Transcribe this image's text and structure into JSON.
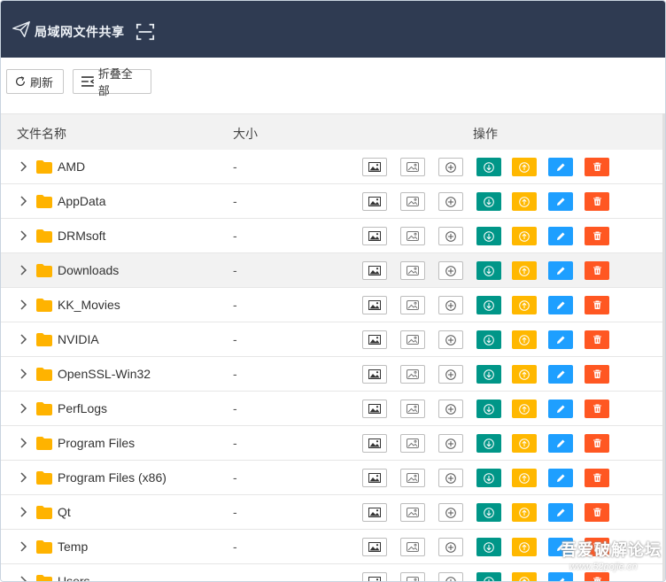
{
  "app": {
    "title": "局域网文件共享"
  },
  "toolbar": {
    "refresh_label": "刷新",
    "collapse_label": "折叠全部"
  },
  "table": {
    "headers": {
      "name": "文件名称",
      "size": "大小",
      "ops": "操作"
    },
    "rows": [
      {
        "name": "AMD",
        "size": "-"
      },
      {
        "name": "AppData",
        "size": "-"
      },
      {
        "name": "DRMsoft",
        "size": "-"
      },
      {
        "name": "Downloads",
        "size": "-"
      },
      {
        "name": "KK_Movies",
        "size": "-"
      },
      {
        "name": "NVIDIA",
        "size": "-"
      },
      {
        "name": "OpenSSL-Win32",
        "size": "-"
      },
      {
        "name": "PerfLogs",
        "size": "-"
      },
      {
        "name": "Program Files",
        "size": "-"
      },
      {
        "name": "Program Files (x86)",
        "size": "-"
      },
      {
        "name": "Qt",
        "size": "-"
      },
      {
        "name": "Temp",
        "size": "-"
      },
      {
        "name": "Users",
        "size": "-"
      }
    ]
  },
  "watermark": {
    "text": "吾爱破解论坛",
    "url": "www.52pojie.cn"
  },
  "colors": {
    "header_bg": "#2f3b52",
    "download": "#009688",
    "upload": "#ffb800",
    "rename": "#1e9fff",
    "delete": "#ff5722",
    "folder": "#ffb300"
  },
  "icons": {
    "logo": "paper-plane-icon",
    "scan": "scan-icon",
    "refresh": "refresh-icon",
    "collapse": "collapse-icon",
    "row_ops": [
      "image-icon",
      "image-outline-icon",
      "plus-circle-icon",
      "download-icon",
      "upload-icon",
      "edit-icon",
      "trash-icon"
    ]
  }
}
